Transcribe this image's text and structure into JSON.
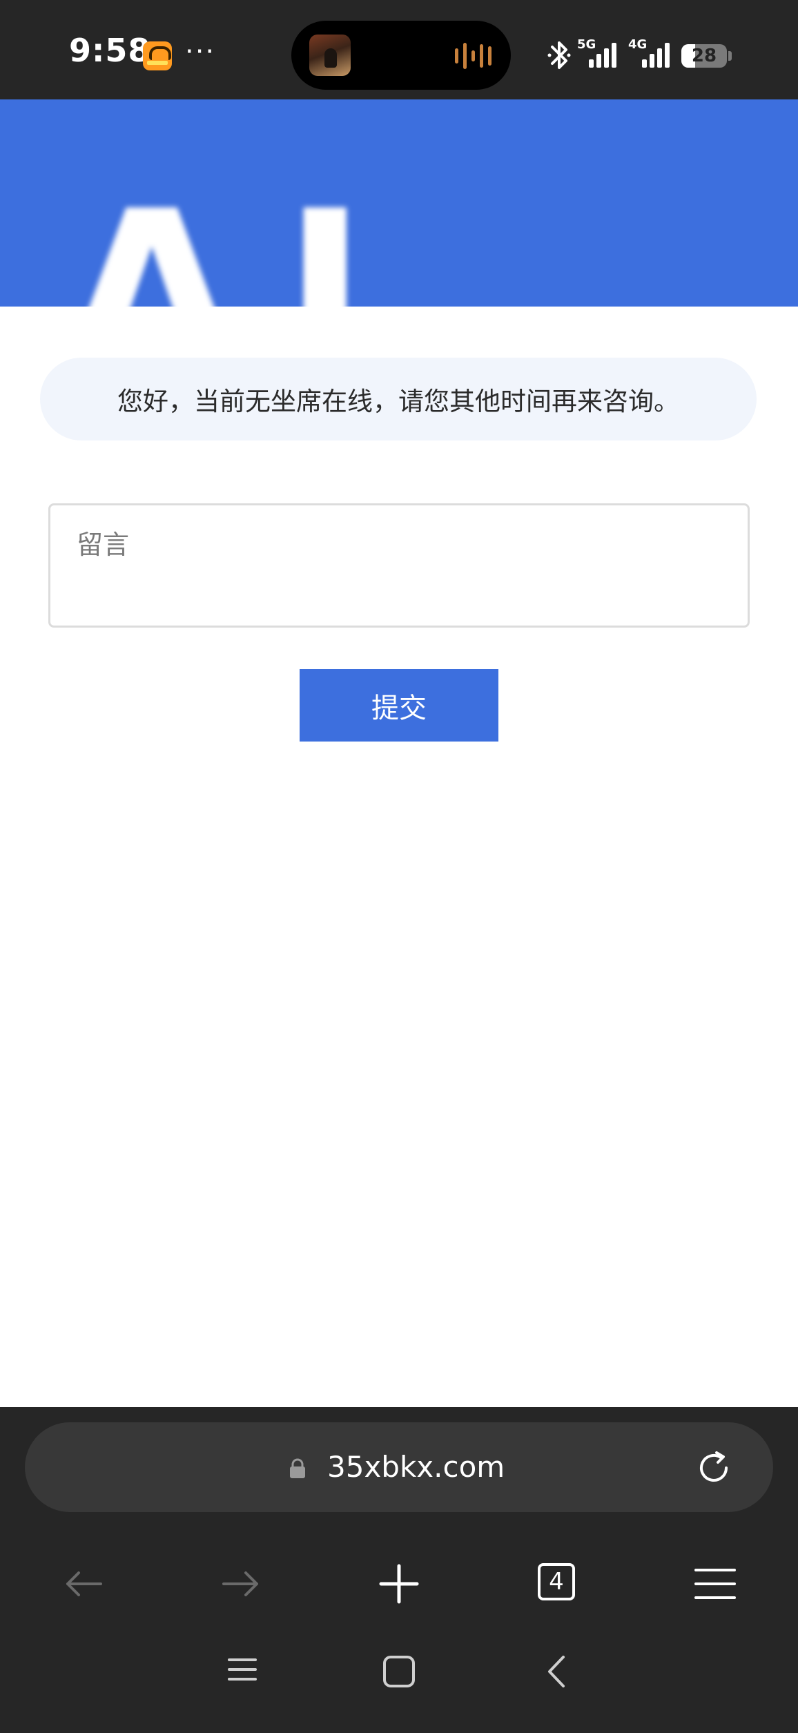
{
  "status_bar": {
    "time": "9:58",
    "more": "···",
    "network_1": "5G",
    "network_2": "4G",
    "battery": "28",
    "icons": [
      "app-badge-icon",
      "music-art-icon",
      "audio-wave-icon",
      "bluetooth-icon",
      "signal-icon",
      "battery-icon"
    ]
  },
  "banner": {
    "logo_text": "AI"
  },
  "main": {
    "notice": "您好，当前无坐席在线，请您其他时间再来咨询。",
    "message_placeholder": "留言",
    "message_value": "",
    "submit_label": "提交"
  },
  "browser": {
    "url": "35xbkx.com",
    "tab_count": "4",
    "toolbar_icons": [
      "back-arrow-icon",
      "forward-arrow-icon",
      "new-tab-plus-icon",
      "tabs-count-icon",
      "menu-hamburger-icon"
    ],
    "system_nav_icons": [
      "recents-icon",
      "home-icon",
      "back-chevron-icon"
    ]
  },
  "colors": {
    "accent": "#3d6fde",
    "status_bar_bg": "#262626",
    "notice_bg": "#f1f5fc",
    "chrome_bg": "#262626",
    "url_bar_bg": "#383838"
  }
}
